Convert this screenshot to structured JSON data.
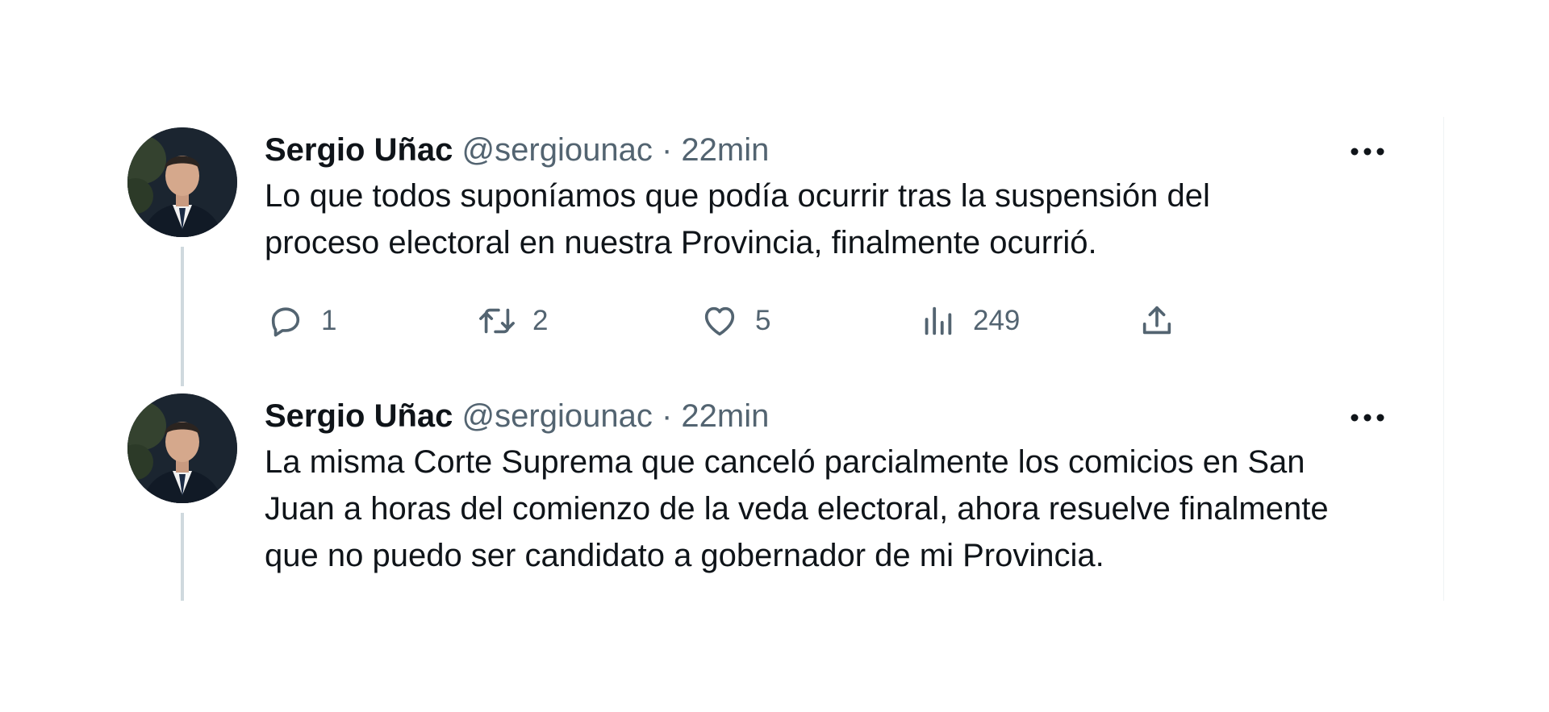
{
  "tweets": [
    {
      "author": {
        "name": "Sergio Uñac",
        "handle": "@sergiounac"
      },
      "separator": "·",
      "time": "22min",
      "text": "Lo que todos suponíamos que podía ocurrir tras la suspensión del\nproceso electoral en nuestra Provincia, finalmente ocurrió.",
      "actions": {
        "replies": "1",
        "retweets": "2",
        "likes": "5",
        "views": "249"
      }
    },
    {
      "author": {
        "name": "Sergio Uñac",
        "handle": "@sergiounac"
      },
      "separator": "·",
      "time": "22min",
      "text": "La misma Corte Suprema que canceló parcialmente los comicios en San\nJuan a horas del comienzo de la veda electoral, ahora resuelve finalmente\nque no puedo ser candidato a gobernador de mi Provincia."
    }
  ],
  "icons": {
    "more": "more-horizontal-icon",
    "reply": "reply-icon",
    "retweet": "retweet-icon",
    "like": "heart-icon",
    "views": "views-icon",
    "share": "share-icon"
  },
  "colors": {
    "text_primary": "#0f1419",
    "text_secondary": "#536471",
    "thread_line": "#cfd9de"
  }
}
